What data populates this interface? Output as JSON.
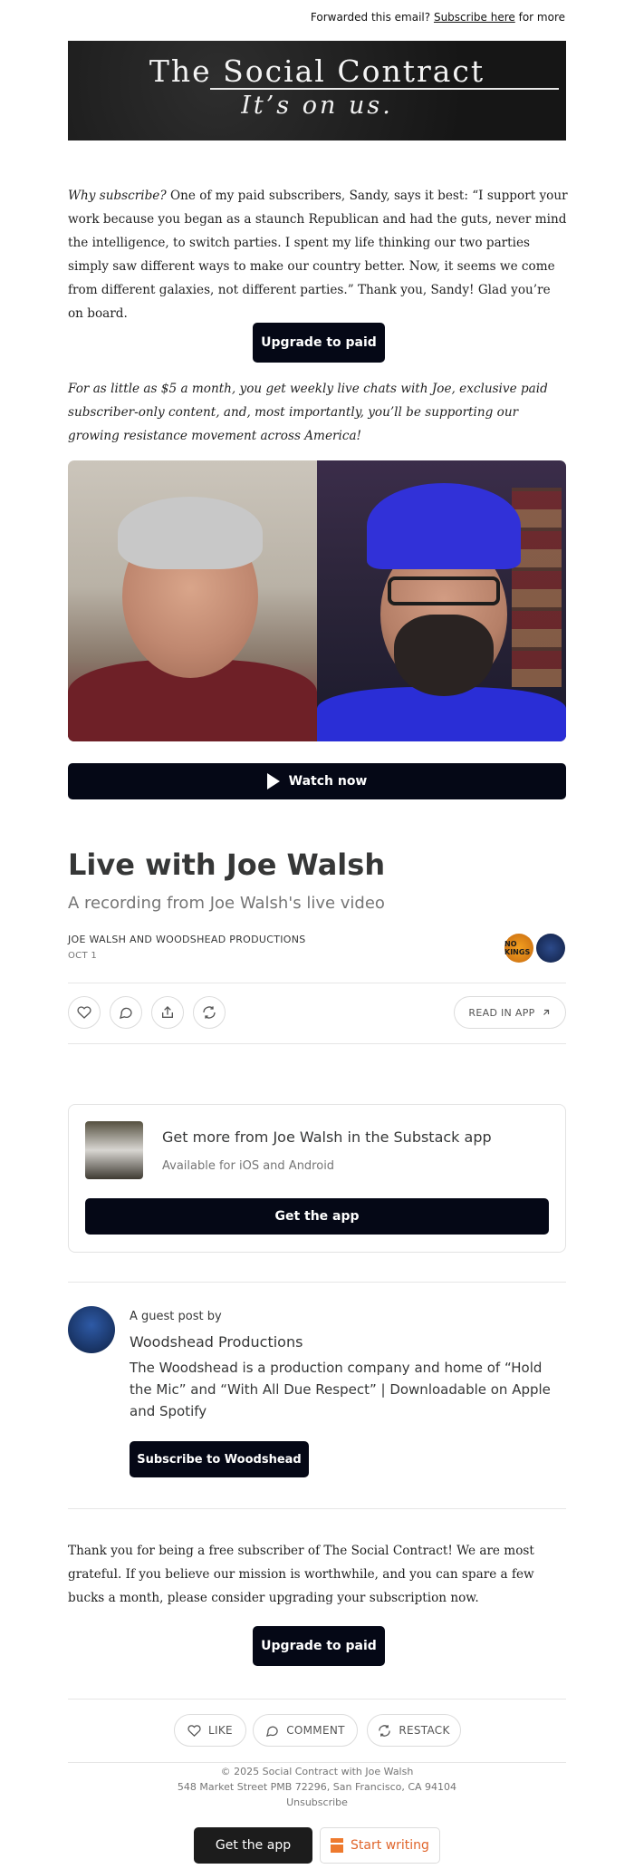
{
  "header": {
    "forward_text": "Forwarded this email?",
    "subscribe_link": "Subscribe here",
    "forward_suffix": "for more"
  },
  "banner": {
    "title": "The Social Contract",
    "tagline": "It’s on us."
  },
  "intro": {
    "lead_italic": "Why subscribe?",
    "body": "One of my paid subscribers, Sandy, says it best: “I support your work because you began as a staunch Republican and had the guts, never mind the intelligence, to switch parties. I spent my life thinking our two parties simply saw different ways to make our country better. Now, it seems we come from different galaxies, not different parties.” Thank you, Sandy! Glad you’re on board."
  },
  "upgrade_button_1": "Upgrade to paid",
  "promo_italic": "For as little as $5 a month, you get weekly live chats with Joe, exclusive paid subscriber-only content, and, most importantly, you’ll be supporting our growing resistance movement across America!",
  "video": {
    "watch_label": "Watch now"
  },
  "post": {
    "title": "Live with Joe Walsh",
    "subtitle": "A recording from Joe Walsh's live video",
    "authors": "JOE WALSH AND WOODSHEAD PRODUCTIONS",
    "date": "OCT 1",
    "avatar_1_text": "NO KINGS",
    "read_in_app": "READ IN APP"
  },
  "app_card": {
    "title": "Get more from Joe Walsh in the Substack app",
    "subtitle": "Available for iOS and Android",
    "button": "Get the app"
  },
  "guest": {
    "label": "A guest post by",
    "name": "Woodshead Productions",
    "description": "The Woodshead is a production company and home of “Hold the Mic” and “With All Due Respect” | Downloadable on Apple and Spotify",
    "button": "Subscribe to Woodshead"
  },
  "closing": {
    "text": "Thank you for being a free subscriber of The Social Contract! We are most grateful. If you believe our mission is worthwhile, and you can spare a few bucks a month, please consider upgrading your subscription now."
  },
  "upgrade_button_2": "Upgrade to paid",
  "actions": {
    "like": "LIKE",
    "comment": "COMMENT",
    "restack": "RESTACK"
  },
  "footer": {
    "copyright": "© 2025 Social Contract with Joe Walsh",
    "address": "548 Market Street PMB 72296, San Francisco, CA 94104",
    "unsubscribe": "Unsubscribe",
    "get_app": "Get the app",
    "start_writing": "Start writing"
  }
}
